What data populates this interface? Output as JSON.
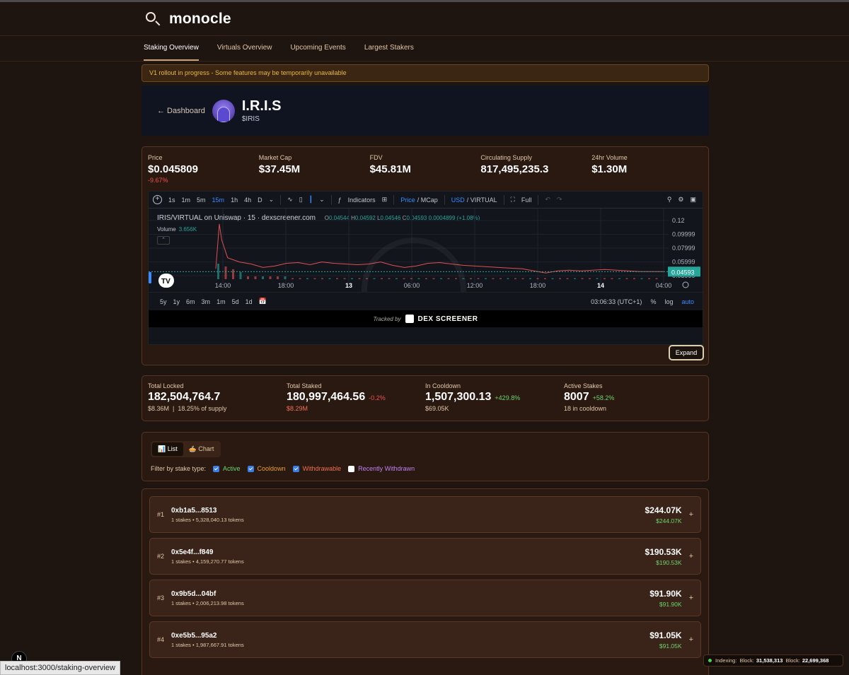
{
  "app": {
    "name": "monocle"
  },
  "nav": {
    "items": [
      "Staking Overview",
      "Virtuals Overview",
      "Upcoming Events",
      "Largest Stakers"
    ]
  },
  "banner": "V1 rollout in progress - Some features may be temporarily unavailable",
  "token": {
    "back": "← Dashboard",
    "name": "I.R.I.S",
    "ticker": "$IRIS"
  },
  "metrics": [
    {
      "label": "Price",
      "value": "$0.045809",
      "change": "-9.67%"
    },
    {
      "label": "Market Cap",
      "value": "$37.45M"
    },
    {
      "label": "FDV",
      "value": "$45.81M"
    },
    {
      "label": "Circulating Supply",
      "value": "817,495,235.3"
    },
    {
      "label": "24hr Volume",
      "value": "$1.30M"
    }
  ],
  "chart": {
    "toolbar": {
      "intervals": [
        "1s",
        "1m",
        "5m",
        "15m",
        "1h",
        "4h",
        "D"
      ],
      "indicators": "Indicators",
      "price": "Price",
      "mcap": "/ MCap",
      "usd": "USD",
      "virtual": "/ VIRTUAL",
      "full": "Full"
    },
    "legend": "IRIS/VIRTUAL on Uniswap · 15 · dexscreener.com",
    "ohlc": {
      "o": "0.04544",
      "h": "0.04592",
      "l": "0.04546",
      "c": "0.04593",
      "chg": "0.0004899 (+1.08%)"
    },
    "volume_label": "Volume",
    "volume_value": "3.656K",
    "ranges": [
      "5y",
      "1y",
      "6m",
      "3m",
      "1m",
      "5d",
      "1d"
    ],
    "clock": "03:06:33 (UTC+1)",
    "pct": "%",
    "log": "log",
    "auto": "auto",
    "tracked_by": "Tracked by",
    "dex_brand": "DEX SCREENER",
    "current_price_label": "0.04593",
    "expand": "Expand"
  },
  "chart_data": {
    "type": "line",
    "title": "IRIS/VIRTUAL on Uniswap · 15 · dexscreener.com",
    "x_ticks": [
      "14:00",
      "18:00",
      "13",
      "06:00",
      "12:00",
      "18:00",
      "14",
      "04:00"
    ],
    "y_ticks": [
      0.12,
      0.09999,
      0.07999,
      0.05999,
      0.03999
    ],
    "ylim": [
      0.035,
      0.125
    ],
    "series": [
      {
        "name": "IRIS/VIRTUAL",
        "x": [
          0,
          0.3,
          0.5,
          1,
          2,
          3,
          4,
          5,
          6,
          7,
          8,
          9,
          10,
          11,
          12,
          13,
          14,
          15,
          16,
          17,
          18,
          19,
          20,
          21,
          22,
          23,
          24,
          25,
          26,
          27,
          28,
          29,
          30,
          31,
          32,
          33,
          34,
          35,
          36,
          37,
          38
        ],
        "values": [
          0.05,
          0.115,
          0.092,
          0.066,
          0.06,
          0.057,
          0.052,
          0.054,
          0.058,
          0.059,
          0.056,
          0.06,
          0.058,
          0.057,
          0.056,
          0.057,
          0.06,
          0.055,
          0.052,
          0.054,
          0.058,
          0.059,
          0.057,
          0.055,
          0.054,
          0.053,
          0.052,
          0.051,
          0.05,
          0.047,
          0.044,
          0.047,
          0.048,
          0.047,
          0.048,
          0.049,
          0.048,
          0.047,
          0.046,
          0.046,
          0.0459
        ]
      }
    ],
    "current_price": 0.04593
  },
  "stats": [
    {
      "label": "Total Locked",
      "value": "182,504,764.7",
      "sub": "$8.36M  |  18.25% of supply"
    },
    {
      "label": "Total Staked",
      "value": "180,997,464.56",
      "change": "-0.2%",
      "change_color": "#ef5050",
      "sub": "$8.29M",
      "sub_color": "#ef7050"
    },
    {
      "label": "In Cooldown",
      "value": "1,507,300.13",
      "change": "+429.8%",
      "change_color": "#6cd46c",
      "sub": "$69.05K"
    },
    {
      "label": "Active Stakes",
      "value": "8007",
      "change": "+58.2%",
      "change_color": "#6cd46c",
      "sub": "18 in cooldown"
    }
  ],
  "view_toggle": {
    "list": "📊 List",
    "chart": "🥧 Chart"
  },
  "filters": {
    "label": "Filter by stake type:",
    "options": [
      {
        "label": "Active",
        "checked": true,
        "color": "#6cd46c"
      },
      {
        "label": "Cooldown",
        "checked": true,
        "color": "#e8a030"
      },
      {
        "label": "Withdrawable",
        "checked": true,
        "color": "#ef7050"
      },
      {
        "label": "Recently Withdrawn",
        "checked": false,
        "color": "#c080f0"
      }
    ]
  },
  "stakers": [
    {
      "rank": "#1",
      "address": "0xb1a5...8513",
      "meta": "1 stakes • 5,328,040.13 tokens",
      "value": "$244.07K",
      "sub": "$244.07K"
    },
    {
      "rank": "#2",
      "address": "0x5e4f...f849",
      "meta": "1 stakes • 4,159,270.77 tokens",
      "value": "$190.53K",
      "sub": "$190.53K"
    },
    {
      "rank": "#3",
      "address": "0x9b5d...04bf",
      "meta": "1 stakes • 2,006,213.98 tokens",
      "value": "$91.90K",
      "sub": "$91.90K"
    },
    {
      "rank": "#4",
      "address": "0xe5b5...95a2",
      "meta": "1 stakes • 1,987,667.91 tokens",
      "value": "$91.05K",
      "sub": "$91.05K"
    }
  ],
  "statusbar": {
    "url": "localhost:3000/staking-overview",
    "indexing": "Indexing:",
    "block1_label": "Block:",
    "block1": "31,538,313",
    "block2_label": "Block:",
    "block2": "22,699,368",
    "next": "N"
  }
}
